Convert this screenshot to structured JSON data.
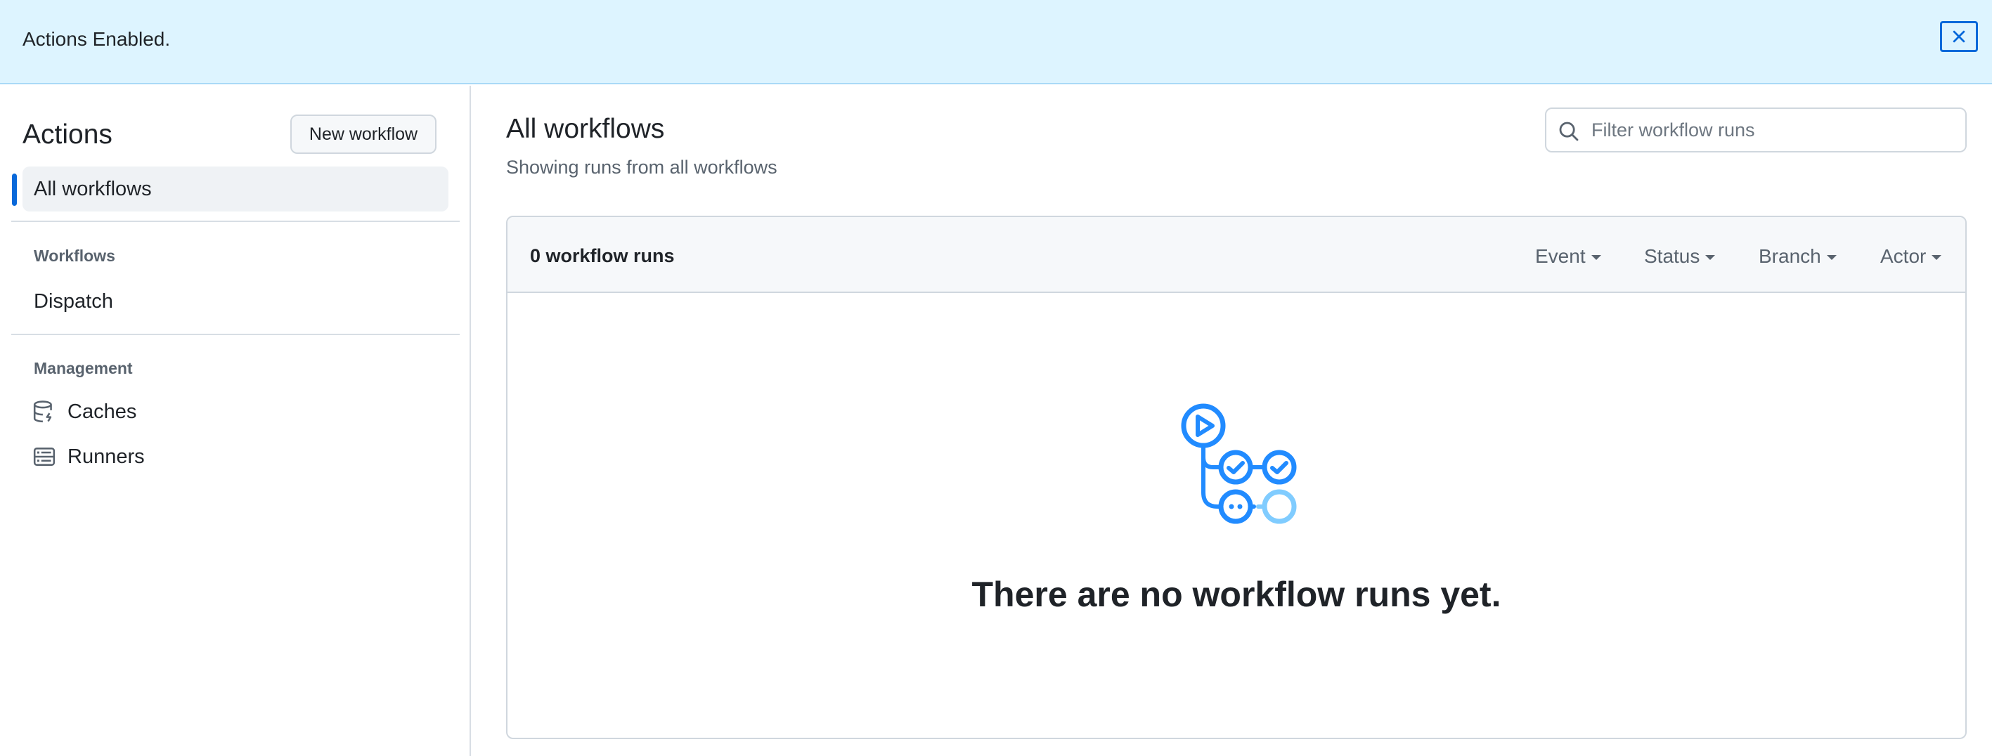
{
  "banner": {
    "message": "Actions Enabled.",
    "close_icon": "close-icon"
  },
  "sidebar": {
    "title": "Actions",
    "new_workflow_label": "New workflow",
    "active_item": "All workflows",
    "sections": [
      {
        "label": "Workflows",
        "items": [
          {
            "label": "Dispatch"
          }
        ]
      },
      {
        "label": "Management",
        "items": [
          {
            "label": "Caches",
            "icon": "database-icon"
          },
          {
            "label": "Runners",
            "icon": "server-icon"
          }
        ]
      }
    ]
  },
  "main": {
    "title": "All workflows",
    "subtitle": "Showing runs from all workflows",
    "search": {
      "placeholder": "Filter workflow runs",
      "value": "",
      "icon": "search-icon"
    },
    "runs_header": {
      "count_label": "0 workflow runs",
      "filters": [
        "Event",
        "Status",
        "Branch",
        "Actor"
      ]
    },
    "empty_state": {
      "icon": "workflow-graph-icon",
      "message": "There are no workflow runs yet."
    }
  },
  "colors": {
    "accent": "#0969da",
    "banner_bg": "#ddf4ff",
    "illustration_blue": "#218bff",
    "illustration_light_blue": "#80ccff"
  }
}
